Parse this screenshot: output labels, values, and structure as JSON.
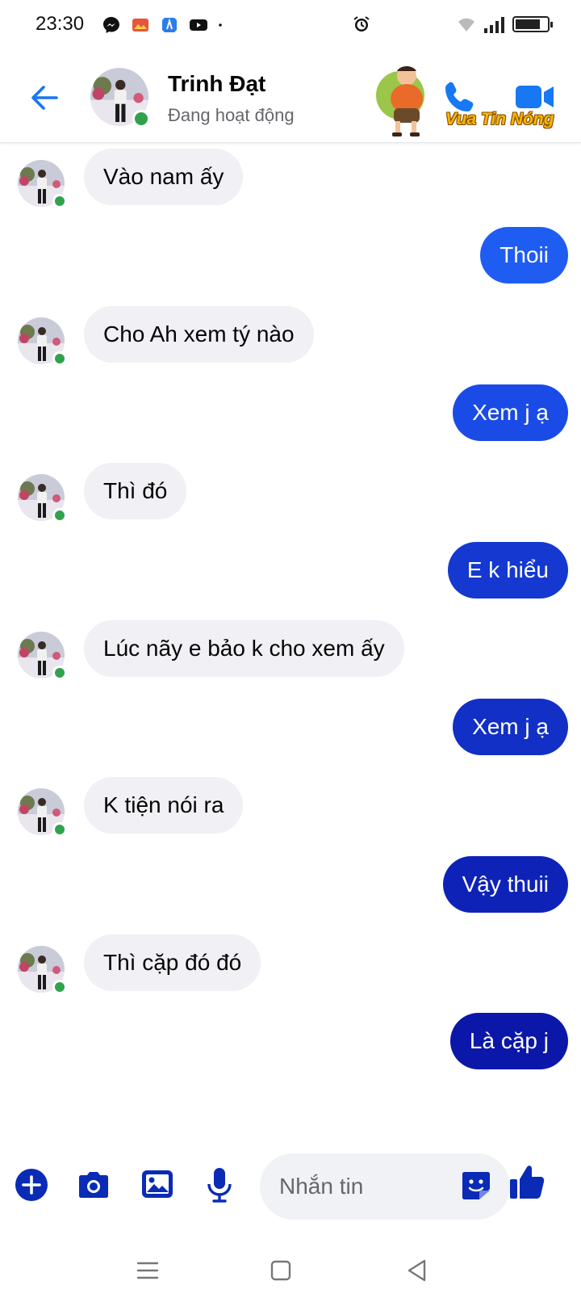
{
  "status_bar": {
    "time": "23:30",
    "notification_icons": [
      "messenger-icon",
      "photos-icon",
      "facebook-lite-icon",
      "youtube-icon",
      "more-dot-icon"
    ],
    "system_icons": [
      "alarm-icon",
      "wifi-icon",
      "signal-icon",
      "battery-icon"
    ]
  },
  "watermark": {
    "text": "Vua Tin Nóng",
    "color": "#f5b800"
  },
  "header": {
    "contact_name": "Trinh Đạt",
    "presence": "Đang hoạt động",
    "icons": [
      "back-arrow-icon",
      "phone-icon",
      "video-camera-icon"
    ]
  },
  "messages": [
    {
      "direction": "in",
      "text": "Vào nam ấy"
    },
    {
      "direction": "out",
      "text": "Thoii"
    },
    {
      "direction": "in",
      "text": "Cho Ah xem tý nào"
    },
    {
      "direction": "out",
      "text": "Xem j ạ"
    },
    {
      "direction": "in",
      "text": "Thì đó"
    },
    {
      "direction": "out",
      "text": "E k hiểu"
    },
    {
      "direction": "in",
      "text": "Lúc nãy e bảo k cho xem ấy"
    },
    {
      "direction": "out",
      "text": "Xem j ạ"
    },
    {
      "direction": "in",
      "text": "K tiện nói ra"
    },
    {
      "direction": "out",
      "text": "Vậy thuii"
    },
    {
      "direction": "in",
      "text": "Thì cặp đó đó"
    },
    {
      "direction": "out",
      "text": "Là cặp j"
    }
  ],
  "composer": {
    "placeholder": "Nhắn tin",
    "icons": [
      "plus-icon",
      "camera-icon",
      "gallery-icon",
      "microphone-icon",
      "sticker-icon",
      "thumbs-up-icon"
    ]
  },
  "nav_bar": {
    "icons": [
      "recent-apps-icon",
      "home-icon",
      "back-icon"
    ]
  },
  "colors": {
    "incoming_bubble": "#f0f0f5",
    "outgoing_gradient": [
      "#1f5cf2",
      "#1a4be6",
      "#1438d0",
      "#1230c6",
      "#0f22b8",
      "#0b17a8"
    ],
    "accent": "#1877f2",
    "online": "#31a24c",
    "composer_icon": "#0a2bb5"
  }
}
